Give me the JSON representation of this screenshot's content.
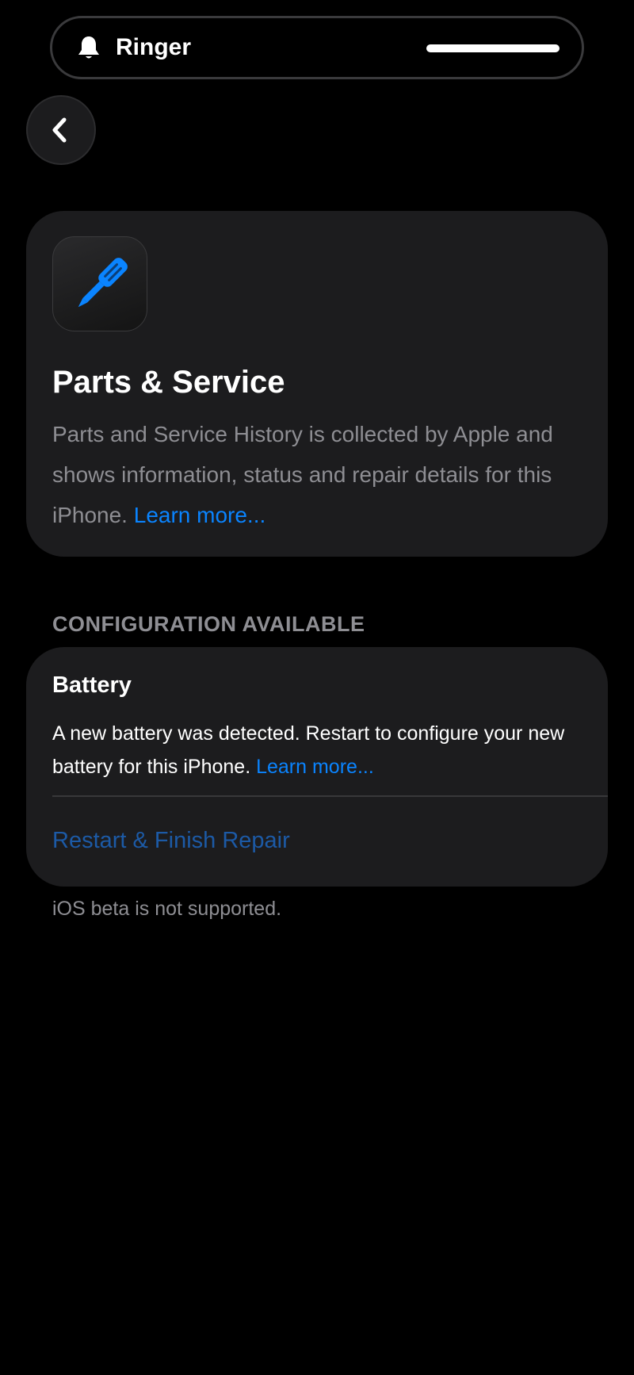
{
  "ringer": {
    "label": "Ringer",
    "icon": "bell-icon",
    "volume_level": 1.0
  },
  "navigation": {
    "back_icon": "chevron-left-icon"
  },
  "info_card": {
    "icon": "screwdriver-icon",
    "icon_color": "#0a84ff",
    "title": "Parts & Service",
    "description": "Parts and Service History is collected by Apple and shows information, status and repair details for this iPhone.",
    "learn_more": "Learn more..."
  },
  "configuration": {
    "section_header": "CONFIGURATION AVAILABLE",
    "battery": {
      "title": "Battery",
      "description": "A new battery was detected. Restart to configure your new battery for this iPhone.",
      "learn_more": "Learn more...",
      "action_label": "Restart & Finish Repair"
    }
  },
  "footer": {
    "note": "iOS beta is not supported."
  },
  "colors": {
    "background": "#000000",
    "card": "#1c1c1e",
    "accent": "#0a84ff",
    "action_disabled": "#1c5aa6",
    "secondary_text": "#8e8e93"
  }
}
